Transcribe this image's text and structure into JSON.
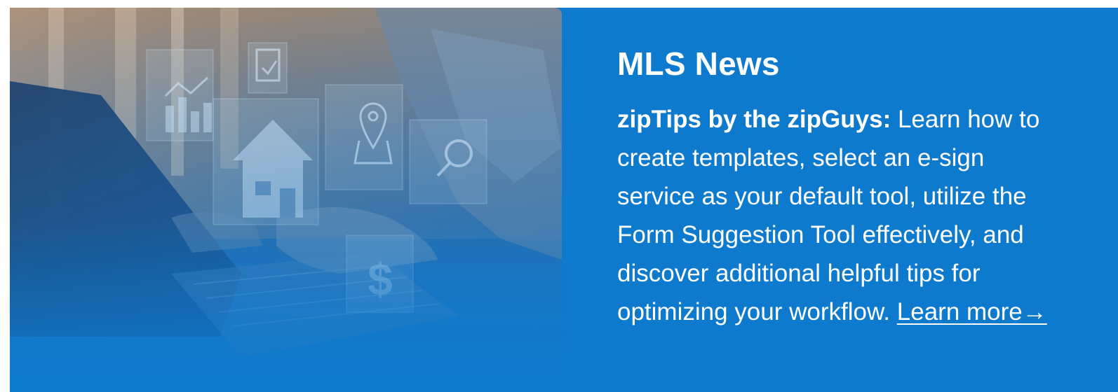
{
  "news": {
    "title": "MLS News",
    "lead": "zipTips by the zipGuys:",
    "body": " Learn how to create templates, select an e-sign service as your default tool, utilize the Form Suggestion Tool effectively, and discover additional helpful tips for optimizing your workflow. ",
    "link_label": "Learn more→"
  },
  "hero_image": {
    "icon_names": [
      "bar-chart-icon",
      "checklist-icon",
      "house-icon",
      "location-pin-icon",
      "magnifier-icon",
      "dollar-icon"
    ],
    "dollar_glyph": "$"
  },
  "colors": {
    "banner": "#0e7acd",
    "text": "#ffffff"
  }
}
